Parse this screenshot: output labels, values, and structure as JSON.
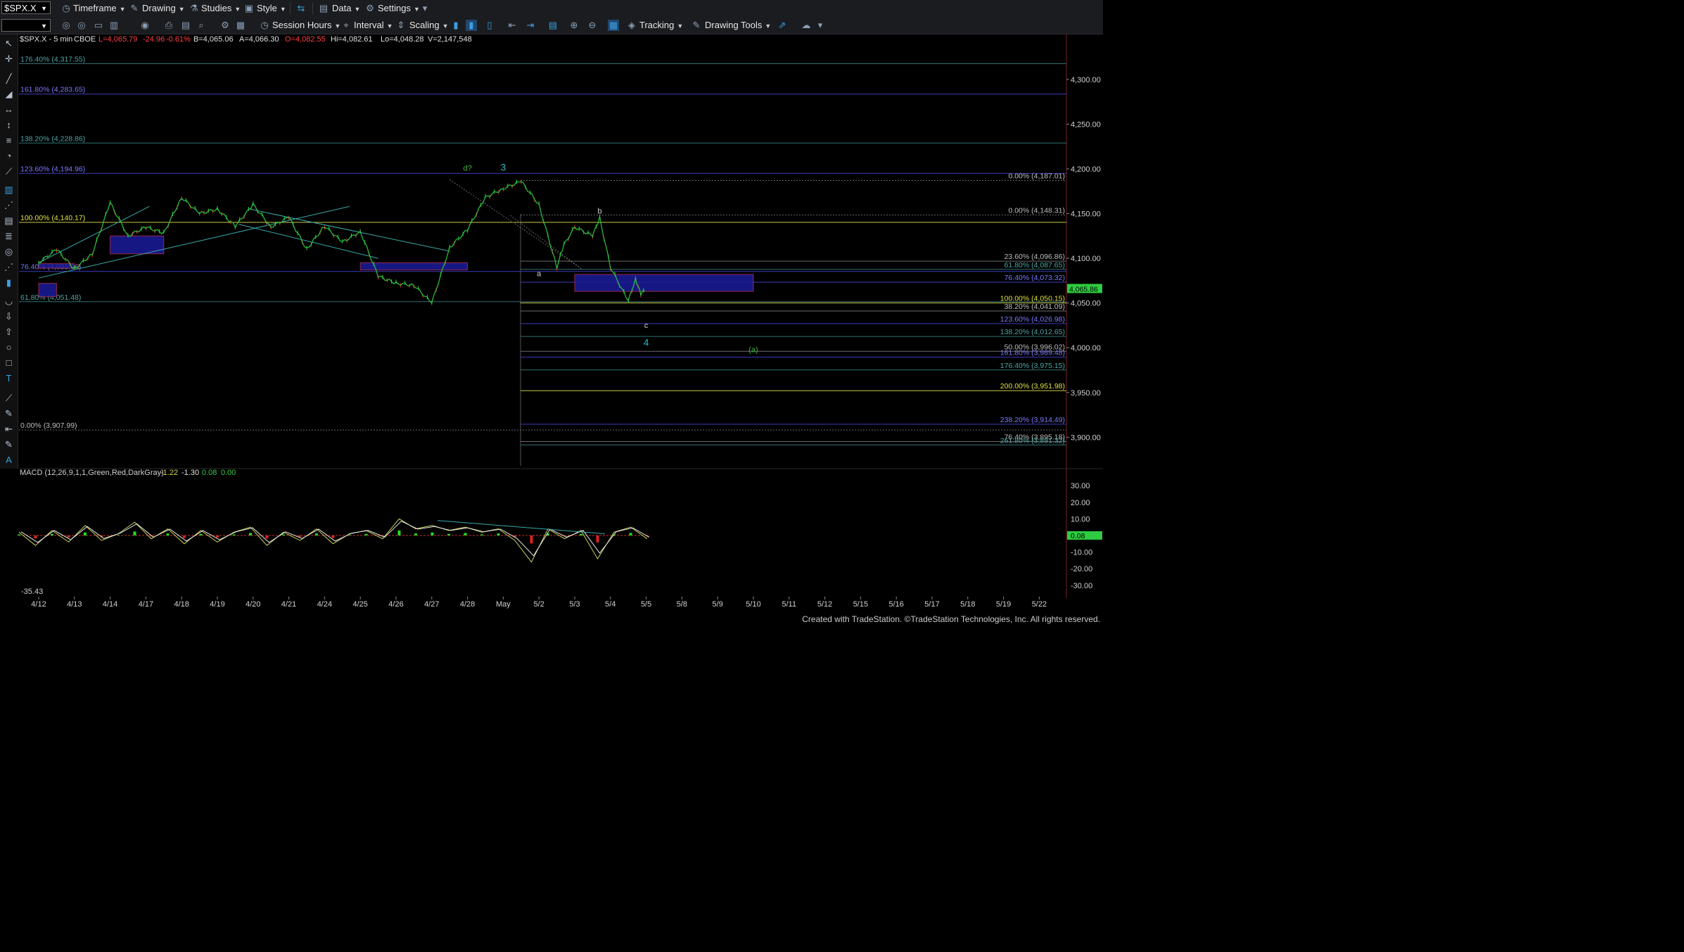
{
  "toolbar1": {
    "symbol": "$SPX.X",
    "items": [
      "Timeframe",
      "Drawing",
      "Studies",
      "Style",
      "Data",
      "Settings"
    ]
  },
  "toolbar2": {
    "items": [
      "Session Hours",
      "Interval",
      "Scaling",
      "Tracking",
      "Drawing Tools"
    ]
  },
  "header": {
    "symbol": "$SPX.X - 5 min",
    "exchange": "CBOE",
    "last": "L=4,065.79",
    "change": "-24.96",
    "pct": "-0.61%",
    "bid": "B=4,065.06",
    "ask": "A=4,066.30",
    "open": "O=4,082.55",
    "high": "Hi=4,082.61",
    "low": "Lo=4,048.28",
    "volume": "V=2,147,548"
  },
  "colors": {
    "up": "#2ecc40",
    "down": "#e03030",
    "fib_teal": "#2f6f73",
    "fib_blue": "#3b3bbd",
    "fib_yellow": "#c8c84a",
    "box_fill": "#1c1c9a",
    "label_blue": "#7a7aff",
    "label_teal": "#4fa6a6",
    "label_yellow": "#e0e040",
    "wave_teal": "#2fb5c0",
    "wave_green": "#44b044"
  },
  "chart_data": [
    {
      "type": "line",
      "title": "$SPX.X - 5 min",
      "x_tick_labels": [
        "4/12",
        "4/13",
        "4/14",
        "4/17",
        "4/18",
        "4/19",
        "4/20",
        "4/21",
        "4/24",
        "4/25",
        "4/26",
        "4/27",
        "4/28",
        "May",
        "5/2",
        "5/3",
        "5/4",
        "5/5",
        "5/8",
        "5/9",
        "5/10",
        "5/11",
        "5/12",
        "5/15",
        "5/16",
        "5/17",
        "5/18",
        "5/19",
        "5/22"
      ],
      "y_ticks": [
        3900,
        3950,
        4000,
        4050,
        4100,
        4150,
        4200,
        4250,
        4300
      ],
      "y_tick_labels": [
        "3,900.00",
        "3,950.00",
        "4,000.00",
        "4,050.00",
        "4,100.00",
        "4,150.00",
        "4,200.00",
        "4,250.00",
        "4,300.00"
      ],
      "ylim": [
        3868,
        4340
      ],
      "last_price_label": "4,065.86",
      "price_path": [
        {
          "x": "4/12",
          "y": 4095
        },
        {
          "x": "4/12b",
          "y": 4110
        },
        {
          "x": "4/13",
          "y": 4088
        },
        {
          "x": "4/13b",
          "y": 4105
        },
        {
          "x": "4/14",
          "y": 4162
        },
        {
          "x": "4/14b",
          "y": 4125
        },
        {
          "x": "4/17",
          "y": 4135
        },
        {
          "x": "4/17b",
          "y": 4128
        },
        {
          "x": "4/18",
          "y": 4168
        },
        {
          "x": "4/18b",
          "y": 4150
        },
        {
          "x": "4/19",
          "y": 4155
        },
        {
          "x": "4/19b",
          "y": 4136
        },
        {
          "x": "4/20",
          "y": 4160
        },
        {
          "x": "4/20b",
          "y": 4135
        },
        {
          "x": "4/21",
          "y": 4146
        },
        {
          "x": "4/21b",
          "y": 4110
        },
        {
          "x": "4/24",
          "y": 4136
        },
        {
          "x": "4/24b",
          "y": 4118
        },
        {
          "x": "4/25",
          "y": 4130
        },
        {
          "x": "4/25b",
          "y": 4080
        },
        {
          "x": "4/26",
          "y": 4072
        },
        {
          "x": "4/26b",
          "y": 4070
        },
        {
          "x": "4/27",
          "y": 4050
        },
        {
          "x": "4/27b",
          "y": 4112
        },
        {
          "x": "4/28",
          "y": 4132
        },
        {
          "x": "4/28b",
          "y": 4168
        },
        {
          "x": "May",
          "y": 4178
        },
        {
          "x": "Mayb",
          "y": 4186
        },
        {
          "x": "5/2",
          "y": 4160
        },
        {
          "x": "5/2b",
          "y": 4090
        },
        {
          "x": "5/2c",
          "y": 4115
        },
        {
          "x": "5/3",
          "y": 4135
        },
        {
          "x": "5/3b",
          "y": 4125
        },
        {
          "x": "5/3c",
          "y": 4145
        },
        {
          "x": "5/4",
          "y": 4090
        },
        {
          "x": "5/4b",
          "y": 4052
        },
        {
          "x": "5/4c",
          "y": 4077
        },
        {
          "x": "5/4d",
          "y": 4060
        },
        {
          "x": "5/5",
          "y": 4066
        }
      ],
      "fib_levels": [
        {
          "label": "176.40% (4,317.55)",
          "value": 4317.55,
          "side": "left",
          "color": "teal"
        },
        {
          "label": "161.80% (4,283.65)",
          "value": 4283.65,
          "side": "left",
          "color": "blue"
        },
        {
          "label": "138.20% (4,228.86)",
          "value": 4228.86,
          "side": "left",
          "color": "teal"
        },
        {
          "label": "123.60% (4,194.96)",
          "value": 4194.96,
          "side": "left",
          "color": "blue"
        },
        {
          "label": "100.00% (4,140.17)",
          "value": 4140.17,
          "side": "left",
          "color": "yellow"
        },
        {
          "label": "76.40% (4,085.36)",
          "value": 4085.36,
          "side": "left",
          "color": "blue"
        },
        {
          "label": "61.80% (4,051.48)",
          "value": 4051.48,
          "side": "left",
          "color": "teal"
        },
        {
          "label": "0.00% (3,907.99)",
          "value": 3907.99,
          "side": "left",
          "color": "gray"
        },
        {
          "label": "0.00% (4,187.01)",
          "value": 4187.01,
          "side": "right",
          "color": "gray"
        },
        {
          "label": "0.00% (4,148.31)",
          "value": 4148.31,
          "side": "right",
          "color": "gray"
        },
        {
          "label": "23.60% (4,096.86)",
          "value": 4096.86,
          "side": "right",
          "color": "gray"
        },
        {
          "label": "61.80% (4,087.65)",
          "value": 4087.65,
          "side": "right",
          "color": "teal"
        },
        {
          "label": "76.40% (4,073.32)",
          "value": 4073.32,
          "side": "right",
          "color": "blue"
        },
        {
          "label": "100.00% (4,050.15)",
          "value": 4050.15,
          "side": "right",
          "color": "yellow"
        },
        {
          "label": "38.20% (4,041.09)",
          "value": 4041.09,
          "side": "right",
          "color": "gray"
        },
        {
          "label": "123.60% (4,026.98)",
          "value": 4026.98,
          "side": "right",
          "color": "blue"
        },
        {
          "label": "138.20% (4,012.65)",
          "value": 4012.65,
          "side": "right",
          "color": "teal"
        },
        {
          "label": "50.00% (3,996.02)",
          "value": 3996.02,
          "side": "right",
          "color": "gray"
        },
        {
          "label": "161.80% (3,989.48)",
          "value": 3989.48,
          "side": "right",
          "color": "blue"
        },
        {
          "label": "176.40% (3,975.15)",
          "value": 3975.15,
          "side": "right",
          "color": "teal"
        },
        {
          "label": "200.00% (3,951.98)",
          "value": 3951.98,
          "side": "right",
          "color": "yellow"
        },
        {
          "label": "238.20% (3,914.49)",
          "value": 3914.49,
          "side": "right",
          "color": "blue"
        },
        {
          "label": "76.40% (3,895.18)",
          "value": 3895.18,
          "side": "right",
          "color": "gray"
        },
        {
          "label": "261.80% (3,891.32)",
          "value": 3891.32,
          "side": "right",
          "color": "teal"
        }
      ],
      "wave_labels": [
        {
          "text": "d?",
          "x": "4/28",
          "y": 4198,
          "color": "green"
        },
        {
          "text": "3",
          "x": "May",
          "y": 4198,
          "color": "teal"
        },
        {
          "text": "a",
          "x": "5/2",
          "y": 4080,
          "color": "white"
        },
        {
          "text": "b",
          "x": "5/3c",
          "y": 4150,
          "color": "white"
        },
        {
          "text": "c",
          "x": "5/5",
          "y": 4022,
          "color": "white"
        },
        {
          "text": "4",
          "x": "5/5",
          "y": 4002,
          "color": "teal"
        },
        {
          "text": "(a)",
          "x": "5/10",
          "y": 3995,
          "color": "green"
        }
      ],
      "boxes": [
        {
          "x0": "4/12",
          "x1": "4/13",
          "y0": 4089,
          "y1": 4094
        },
        {
          "x0": "4/12",
          "x1": "4/12b",
          "y0": 4057,
          "y1": 4072
        },
        {
          "x0": "4/14",
          "x1": "4/17b",
          "y0": 4105,
          "y1": 4125
        },
        {
          "x0": "4/25",
          "x1": "4/28",
          "y0": 4087,
          "y1": 4095
        },
        {
          "x0": "5/3",
          "x1": "5/10",
          "y0": 4063,
          "y1": 4082
        }
      ]
    },
    {
      "type": "line",
      "title": "MACD (12,26,9,1,1,Green,Red,DarkGray)",
      "values_label": [
        "-1.22",
        "-1.30",
        "0.08",
        "0.00"
      ],
      "y_ticks": [
        -30,
        -20,
        -10,
        0,
        10,
        20,
        30
      ],
      "y_tick_labels": [
        "-30.00",
        "-20.00",
        "-10.00",
        "0.08",
        "10.00",
        "20.00",
        "30.00"
      ],
      "ylim": [
        -36,
        36
      ],
      "min_label": "-35.43",
      "series": [
        {
          "values": [
            2,
            -6,
            3,
            -4,
            6,
            -3,
            1,
            8,
            -2,
            4,
            -5,
            3,
            -4,
            2,
            5,
            -6,
            2,
            -3,
            4,
            -5,
            1,
            3,
            -2,
            10,
            4,
            6,
            3,
            5,
            2,
            4,
            -3,
            -16,
            4,
            -2,
            3,
            -14,
            2,
            5,
            -2
          ]
        }
      ]
    }
  ],
  "footer": "Created with TradeStation. ©TradeStation Technologies, Inc. All rights reserved."
}
